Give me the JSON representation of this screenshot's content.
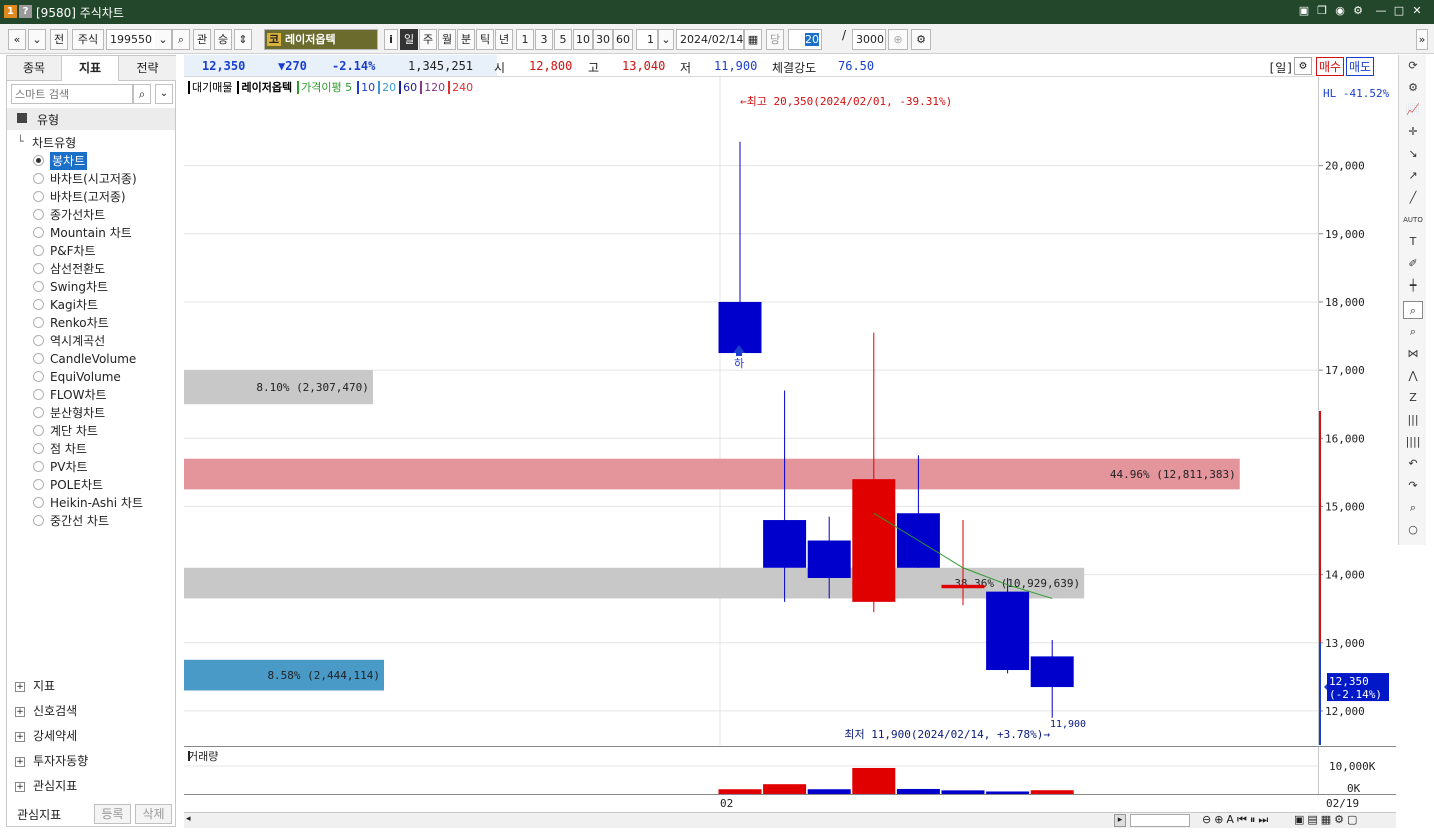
{
  "window": {
    "icon1": "1",
    "icon2": "?",
    "title": "[9580] 주식차트",
    "controls": [
      "layout-icon",
      "copy-icon",
      "camera-icon",
      "gear-icon",
      "minimize-icon",
      "maximize-icon",
      "close-icon"
    ]
  },
  "toolbar": {
    "prev_prev": "«",
    "prev": "»",
    "all_label": "전",
    "market_select": "주식",
    "code_value": "199550",
    "search_icon": "search-icon",
    "rel_label": "관",
    "up_label": "승",
    "stock_badge": "코",
    "stock_name": "레이저옵텍",
    "info_btn": "i",
    "periods": [
      "일",
      "주",
      "월",
      "분",
      "틱",
      "년"
    ],
    "minutes": [
      "1",
      "3",
      "5",
      "10",
      "30",
      "60"
    ],
    "interval_value": "1",
    "date_value": "2024/02/14",
    "today_label": "당",
    "count_value": "20",
    "slash": "/",
    "total_value": "3000"
  },
  "left_panel": {
    "tabs": [
      "종목",
      "지표",
      "전략"
    ],
    "active_tab": "지표",
    "search_placeholder": "스마트 검색",
    "section_title": "유형",
    "tree_title": "차트유형",
    "chart_types": [
      "봉차트",
      "바차트(시고저종)",
      "바차트(고저종)",
      "종가선차트",
      "Mountain 차트",
      "P&F차트",
      "삼선전환도",
      "Swing차트",
      "Kagi차트",
      "Renko차트",
      "역시계곡선",
      "CandleVolume",
      "EquiVolume",
      "FLOW차트",
      "분산형차트",
      "계단 차트",
      "점 차트",
      "PV차트",
      "POLE차트",
      "Heikin-Ashi 차트",
      "중간선 차트"
    ],
    "selected_type": "봉차트",
    "groups": [
      "지표",
      "신호검색",
      "강세약세",
      "투자자동향",
      "관심지표"
    ],
    "footer_label": "관심지표",
    "register_btn": "등록",
    "delete_btn": "삭제"
  },
  "quote_bar": {
    "price": "12,350",
    "change": "▼270",
    "change_pct": "-2.14%",
    "volume": "1,345,251",
    "open_label": "시",
    "open": "12,800",
    "high_label": "고",
    "high": "13,040",
    "low_label": "저",
    "low": "11,900",
    "strength_label": "체결강도",
    "strength": "76.50",
    "period_tag": "[일]",
    "buy_btn": "매수",
    "sell_btn": "매도"
  },
  "legend": {
    "items": [
      "대기매물",
      "레이저옵텍",
      "가격이평 5",
      "10",
      "20",
      "60",
      "120",
      "240"
    ],
    "colors": [
      "#000000",
      "#000000",
      "#2e9a2e",
      "#1a3fcf",
      "#3a9ad9",
      "#1a1a9a",
      "#8a3a8a",
      "#e03030"
    ]
  },
  "y_axis": {
    "hl_label": "HL -41.52%",
    "current_price": "12,350",
    "current_pct": "(-2.14%)"
  },
  "chart_data": {
    "type": "candlestick",
    "ylim": [
      11500,
      21300
    ],
    "yticks": [
      12000,
      13000,
      14000,
      15000,
      16000,
      17000,
      18000,
      19000,
      20000
    ],
    "ytick_labels": [
      "12,000",
      "13,000",
      "14,000",
      "15,000",
      "16,000",
      "17,000",
      "18,000",
      "19,000",
      "20,000"
    ],
    "x_label": "02",
    "x_end_label": "02/19",
    "candles": [
      {
        "open": 18000,
        "high": 20350,
        "low": 17250,
        "close": 17250,
        "color": "blue"
      },
      {
        "open": 14800,
        "high": 16700,
        "low": 13600,
        "close": 14100,
        "color": "blue"
      },
      {
        "open": 14500,
        "high": 14850,
        "low": 13650,
        "close": 13950,
        "color": "blue"
      },
      {
        "open": 13600,
        "high": 17550,
        "low": 13450,
        "close": 15400,
        "color": "red"
      },
      {
        "open": 14900,
        "high": 15750,
        "low": 14100,
        "close": 14100,
        "color": "blue"
      },
      {
        "open": 13800,
        "high": 14800,
        "low": 13550,
        "close": 13850,
        "color": "red"
      },
      {
        "open": 13750,
        "high": 13950,
        "low": 12550,
        "close": 12600,
        "color": "blue"
      },
      {
        "open": 12800,
        "high": 13040,
        "low": 11900,
        "close": 12350,
        "color": "blue"
      }
    ],
    "ma5": [
      14900,
      14500,
      14100,
      13850,
      13650
    ],
    "volume_ylim": [
      0,
      10000
    ],
    "volume_tick_labels": [
      "10,000K",
      "0K"
    ],
    "volume": [
      1700,
      3500,
      1700,
      9300,
      1800,
      1300,
      900,
      1345
    ],
    "volume_colors": [
      "red",
      "red",
      "blue",
      "red",
      "blue",
      "blue",
      "blue",
      "red"
    ],
    "volume_profile": [
      {
        "low": 16500,
        "high": 17000,
        "label": "8.10% (2,307,470)",
        "color": "#c8c8c8",
        "length": 0.17
      },
      {
        "low": 15250,
        "high": 15700,
        "label": "44.96% (12,811,383)",
        "color": "#e4959c",
        "length": 0.95
      },
      {
        "low": 13650,
        "high": 14100,
        "label": "38.36% (10,929,639)",
        "color": "#c8c8c8",
        "length": 0.81
      },
      {
        "low": 12300,
        "high": 12750,
        "label": "8.58% (2,444,114)",
        "color": "#4a9ac8",
        "length": 0.18
      }
    ],
    "annotations": {
      "high_text": "←최고 20,350(2024/02/01, -39.31%)",
      "low_text": "최저 11,900(2024/02/14, +3.78%)→",
      "low_value": "11,900",
      "marker_text": "하"
    },
    "volume_title": "거래량"
  }
}
